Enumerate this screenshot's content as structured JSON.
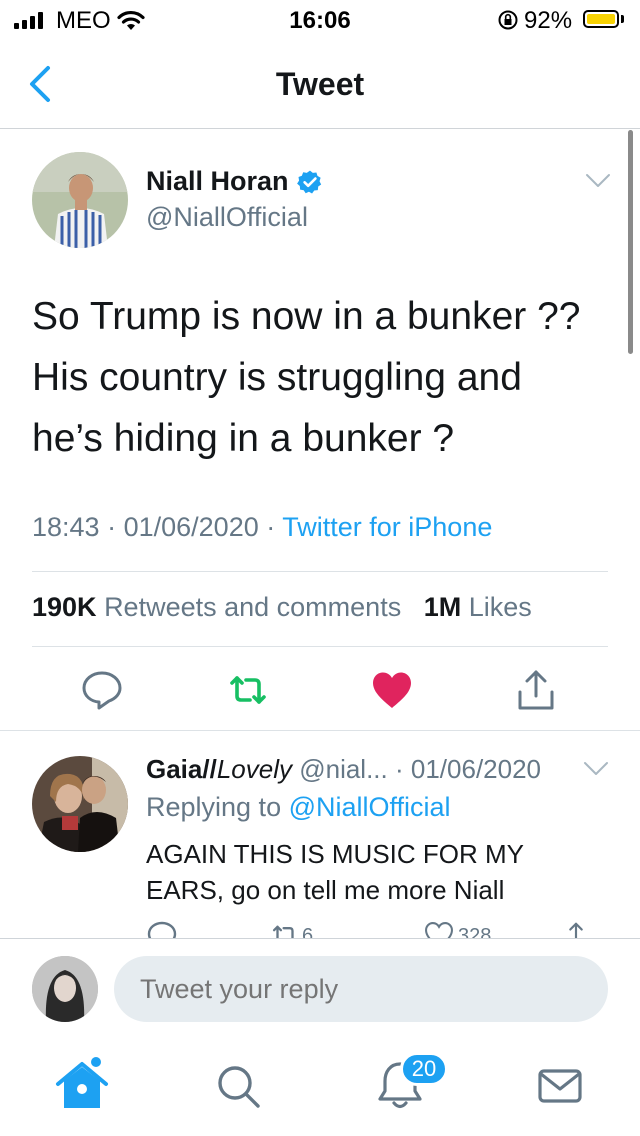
{
  "status_bar": {
    "carrier": "MEO",
    "time": "16:06",
    "battery_percent": "92%",
    "battery_level": 0.92,
    "battery_color": "#f7d203"
  },
  "nav": {
    "title": "Tweet",
    "back_icon": "chevron-left-icon"
  },
  "tweet": {
    "author_name": "Niall Horan",
    "verified": true,
    "handle": "@NiallOfficial",
    "text_lines": [
      "So Trump is now in a bunker ??",
      "His country is struggling and",
      "he’s hiding in a bunker ?"
    ],
    "time": "18:43",
    "date": "01/06/2020",
    "source": "Twitter for iPhone",
    "retweets_count": "190K",
    "retweets_label": "Retweets and comments",
    "likes_count": "1M",
    "likes_label": "Likes",
    "liked": true,
    "actions": [
      "comment-icon",
      "retweet-icon",
      "like-icon",
      "share-icon"
    ]
  },
  "reply": {
    "author_name": "Gaia//",
    "author_name_italic": "Lovely",
    "handle": "@nial...",
    "date": "01/06/2020",
    "replying_prefix": "Replying to",
    "replying_to": "@NiallOfficial",
    "text": "AGAIN THIS IS MUSIC FOR MY EARS, go on tell me more Niall",
    "retweets": "6",
    "likes": "328"
  },
  "composer": {
    "placeholder": "Tweet your reply"
  },
  "tab_bar": {
    "items": [
      "home-icon",
      "search-icon",
      "notifications-icon",
      "messages-icon"
    ],
    "notifications_badge": "20"
  },
  "colors": {
    "accent": "#1da1f2",
    "retweet_green": "#17bf63",
    "like_red": "#e0245e",
    "secondary_text": "#657786"
  }
}
